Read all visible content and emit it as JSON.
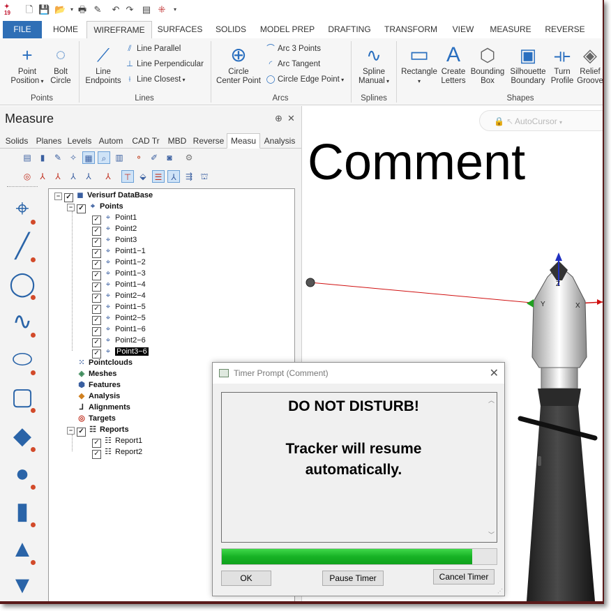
{
  "ribbon_tabs": [
    "FILE",
    "HOME",
    "WIREFRAME",
    "SURFACES",
    "SOLIDS",
    "MODEL PREP",
    "DRAFTING",
    "TRANSFORM",
    "VIEW",
    "MEASURE",
    "REVERSE"
  ],
  "ribbon": {
    "point_position": "Point\nPosition",
    "bolt_circle": "Bolt\nCircle",
    "line_endpoints": "Line\nEndpoints",
    "line_parallel": "Line Parallel",
    "line_perpendicular": "Line Perpendicular",
    "line_closest": "Line Closest",
    "circle_center_point": "Circle\nCenter Point",
    "arc_3_points": "Arc 3 Points",
    "arc_tangent": "Arc Tangent",
    "circle_edge_point": "Circle Edge Point",
    "spline_manual": "Spline\nManual",
    "rectangle": "Rectangle",
    "create_letters": "Create\nLetters",
    "bounding_box": "Bounding\nBox",
    "silhouette_boundary": "Silhouette\nBoundary",
    "turn_profile": "Turn\nProfile",
    "relief_groove": "Relief\nGroove",
    "groups": {
      "points": "Points",
      "lines": "Lines",
      "arcs": "Arcs",
      "splines": "Splines",
      "shapes": "Shapes"
    }
  },
  "panel": {
    "title": "Measure",
    "pin": "⊕",
    "close": "✕",
    "tabs": [
      "Solids",
      "Planes",
      "Levels",
      "Autom",
      "CAD Tr",
      "MBD",
      "Reverse",
      "Measu",
      "Analysis"
    ]
  },
  "tree": {
    "root": "Verisurf DataBase",
    "points_label": "Points",
    "points": [
      "Point1",
      "Point2",
      "Point3",
      "Point1−1",
      "Point1−2",
      "Point1−3",
      "Point1−4",
      "Point2−4",
      "Point1−5",
      "Point2−5",
      "Point1−6",
      "Point2−6",
      "Point3−6"
    ],
    "folders": [
      "Pointclouds",
      "Meshes",
      "Features",
      "Analysis",
      "Alignments",
      "Targets"
    ],
    "reports_label": "Reports",
    "reports": [
      "Report1",
      "Report2"
    ]
  },
  "viewport": {
    "comment": "Comment",
    "autocursor": "AutoCursor",
    "axis_y": "Y",
    "axis_x": "X",
    "axis_z": "Z"
  },
  "dialog": {
    "title": "Timer Prompt (Comment)",
    "line1": "DO NOT DISTURB!",
    "line2": "Tracker will resume",
    "line3": "automatically.",
    "progress": 0.91,
    "ok": "OK",
    "pause": "Pause Timer",
    "cancel": "Cancel Timer"
  },
  "colors": {
    "file_tab": "#2f6fb6",
    "progress": "#17b225",
    "icon_blue": "#2a6fbf",
    "laser": "#d01010"
  }
}
